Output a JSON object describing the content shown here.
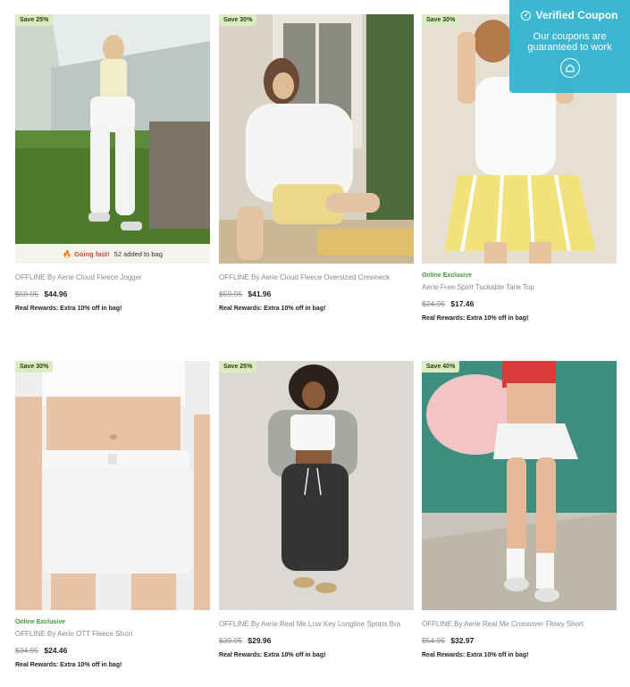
{
  "coupon": {
    "title": "Verified Coupon",
    "subtitle": "Our coupons are guaranteed to work",
    "check_icon": "check-circle-icon",
    "home_icon": "home-icon",
    "background": "#34b3d2"
  },
  "products": [
    {
      "badge": "Save 25%",
      "going_fast": {
        "label": "Going fast!",
        "count": "52 added to bag"
      },
      "exclusive": "",
      "name": "OFFLINE By Aerie Cloud Fleece Jogger",
      "old_price": "$59.95",
      "new_price": "$44.96",
      "rewards": "Real Rewards: Extra 10% off in bag!"
    },
    {
      "badge": "Save 30%",
      "exclusive": "",
      "name": "OFFLINE By Aerie Cloud Fleece Oversized Crewneck",
      "old_price": "$59.95",
      "new_price": "$41.96",
      "rewards": "Real Rewards: Extra 10% off in bag!"
    },
    {
      "badge": "Save 30%",
      "exclusive": "Online Exclusive",
      "name": "Aerie Free Spirit Tuckable Tank Top",
      "old_price": "$24.95",
      "new_price": "$17.46",
      "rewards": "Real Rewards: Extra 10% off in bag!"
    },
    {
      "badge": "Save 30%",
      "exclusive": "Online Exclusive",
      "name": "OFFLINE By Aerie OTT Fleece Short",
      "old_price": "$34.95",
      "new_price": "$24.46",
      "rewards": "Real Rewards: Extra 10% off in bag!"
    },
    {
      "badge": "Save 25%",
      "exclusive": "",
      "name": "OFFLINE By Aerie Real Me Low Key Longline Sports Bra",
      "old_price": "$39.95",
      "new_price": "$29.96",
      "rewards": "Real Rewards: Extra 10% off in bag!"
    },
    {
      "badge": "Save 40%",
      "exclusive": "",
      "name": "OFFLINE By Aerie Real Me Crossover Flowy Short",
      "old_price": "$54.95",
      "new_price": "$32.97",
      "rewards": "Real Rewards: Extra 10% off in bag!"
    }
  ]
}
